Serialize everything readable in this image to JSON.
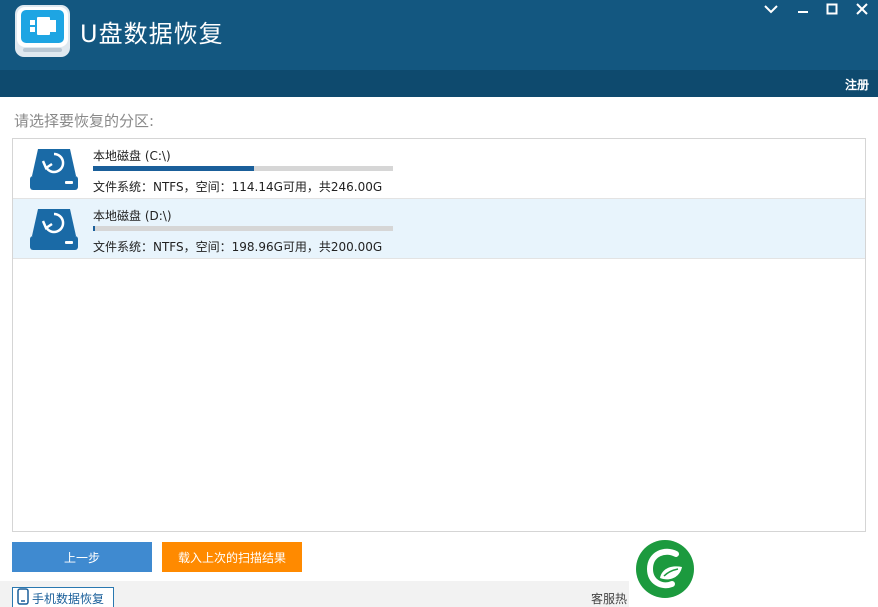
{
  "app": {
    "title": "U盘数据恢复"
  },
  "window_controls": {
    "minimize_icon": "chevron-down-icon",
    "restore_icon": "minimize-icon",
    "maximize_icon": "maximize-icon",
    "close_icon": "close-icon"
  },
  "menubar": {
    "register_label": "注册"
  },
  "main": {
    "section_label": "请选择要恢复的分区:",
    "partitions": [
      {
        "name": "本地磁盘 (C:\\)",
        "info": "文件系统：NTFS，空间：114.14G可用，共246.00G",
        "used_fraction": 0.536,
        "selected": false
      },
      {
        "name": "本地磁盘 (D:\\)",
        "info": "文件系统：NTFS，空间：198.96G可用，共200.00G",
        "used_fraction": 0.005,
        "selected": true
      }
    ]
  },
  "buttons": {
    "prev_label": "上一步",
    "load_label": "载入上次的扫描结果"
  },
  "footer": {
    "phone_recovery_label": "手机数据恢复",
    "hotline_label": "客服热"
  },
  "colors": {
    "titlebar": "#135780",
    "menubar": "#0e4a6e",
    "usage_fill": "#1a5f9a",
    "prev_button": "#3f8ad0",
    "load_button": "#ff8a00",
    "selected_row": "#e8f4fc",
    "brand_green": "#1c9a3e"
  }
}
